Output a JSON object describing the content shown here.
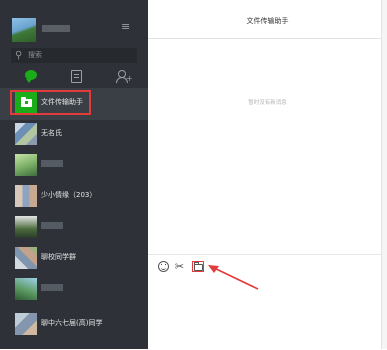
{
  "window": {
    "title": "文件传输助手",
    "empty_message": "暂时没有新消息"
  },
  "profile": {
    "name_redacted": true
  },
  "icons": {
    "menu": "≡",
    "search": "search-icon",
    "chat_tab": "chat-bubble-icon",
    "contacts_tab": "contacts-icon",
    "add_friend_tab": "add-friend-icon",
    "emoji": "emoji-icon",
    "screenshot": "scissors-icon",
    "send_file": "folder-icon"
  },
  "search": {
    "placeholder": "搜索"
  },
  "chats": [
    {
      "name": "文件传输助手",
      "avatar": "file-transfer",
      "active": true,
      "highlighted": true
    },
    {
      "name": "无名氏",
      "avatar": "photo"
    },
    {
      "name": "",
      "avatar": "photo",
      "redacted": true
    },
    {
      "name": "少小情缘（203）",
      "avatar": "group"
    },
    {
      "name": "",
      "avatar": "photo",
      "redacted": true
    },
    {
      "name": "聊校同学群",
      "avatar": "group"
    },
    {
      "name": "",
      "avatar": "photo",
      "redacted": true
    },
    {
      "name": "聊中六七届(高)同学",
      "avatar": "group"
    }
  ],
  "colors": {
    "sidebar_bg": "#2e3238",
    "accent_green": "#1aad19",
    "highlight_red": "#e23b3b"
  }
}
